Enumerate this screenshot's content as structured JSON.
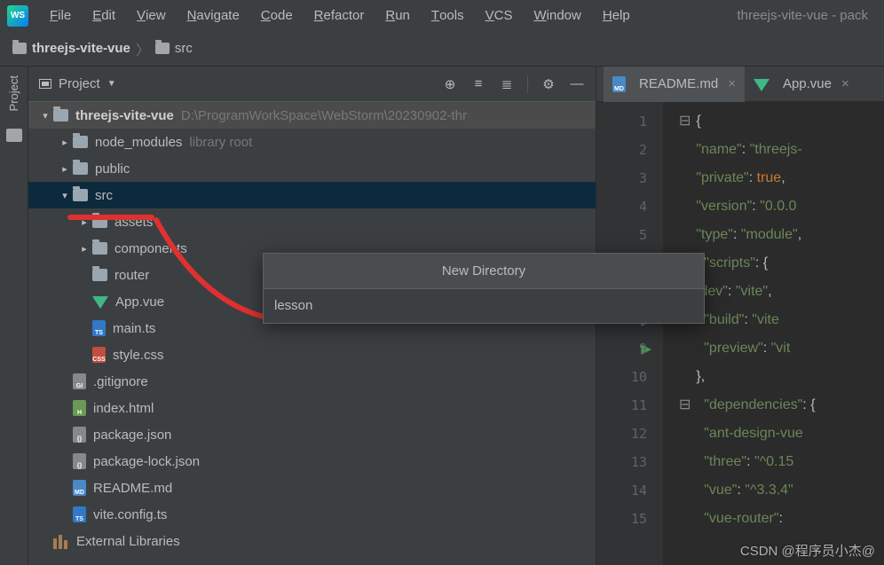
{
  "menubar": {
    "items": [
      "File",
      "Edit",
      "View",
      "Navigate",
      "Code",
      "Refactor",
      "Run",
      "Tools",
      "VCS",
      "Window",
      "Help"
    ],
    "window_title": "threejs-vite-vue - pack"
  },
  "breadcrumb": {
    "project": "threejs-vite-vue",
    "path": "src"
  },
  "side_tab": {
    "label": "Project"
  },
  "panel": {
    "title": "Project",
    "tools": [
      "target",
      "collapse",
      "expand",
      "divider",
      "gear",
      "hide"
    ]
  },
  "tree": [
    {
      "depth": 0,
      "exp": "v",
      "icon": "folder",
      "label": "threejs-vite-vue",
      "suffix": "D:\\ProgramWorkSpace\\WebStorm\\20230902-thr",
      "root": true
    },
    {
      "depth": 1,
      "exp": ">",
      "icon": "folder",
      "label": "node_modules",
      "suffix": "library root"
    },
    {
      "depth": 1,
      "exp": ">",
      "icon": "folder",
      "label": "public"
    },
    {
      "depth": 1,
      "exp": "v",
      "icon": "folder",
      "label": "src",
      "sel": true
    },
    {
      "depth": 2,
      "exp": ">",
      "icon": "folder",
      "label": "assets"
    },
    {
      "depth": 2,
      "exp": ">",
      "icon": "folder",
      "label": "components"
    },
    {
      "depth": 2,
      "exp": "",
      "icon": "folder",
      "label": "router"
    },
    {
      "depth": 2,
      "exp": "",
      "icon": "vue",
      "label": "App.vue"
    },
    {
      "depth": 2,
      "exp": "",
      "icon": "ts",
      "label": "main.ts"
    },
    {
      "depth": 2,
      "exp": "",
      "icon": "css",
      "label": "style.css"
    },
    {
      "depth": 1,
      "exp": "",
      "icon": "git",
      "label": ".gitignore"
    },
    {
      "depth": 1,
      "exp": "",
      "icon": "html",
      "label": "index.html"
    },
    {
      "depth": 1,
      "exp": "",
      "icon": "json",
      "label": "package.json"
    },
    {
      "depth": 1,
      "exp": "",
      "icon": "json",
      "label": "package-lock.json"
    },
    {
      "depth": 1,
      "exp": "",
      "icon": "md",
      "label": "README.md"
    },
    {
      "depth": 1,
      "exp": "",
      "icon": "ts",
      "label": "vite.config.ts"
    },
    {
      "depth": 0,
      "exp": "",
      "icon": "lib",
      "label": "External Libraries"
    }
  ],
  "tabs": [
    {
      "icon": "md",
      "label": "README.md"
    },
    {
      "icon": "vue",
      "label": "App.vue"
    }
  ],
  "code": {
    "lines": [
      {
        "n": 1,
        "fold": true,
        "text_html": "<span class='p'>{</span>"
      },
      {
        "n": 2,
        "text_html": "  <span class='s'>\"name\"</span><span class='p'>: </span><span class='s'>\"threejs-</span>"
      },
      {
        "n": 3,
        "text_html": "  <span class='s'>\"private\"</span><span class='p'>: </span><span class='k'>true</span><span class='p'>,</span>"
      },
      {
        "n": 4,
        "text_html": "  <span class='s'>\"version\"</span><span class='p'>: </span><span class='s'>\"0.0.0</span>"
      },
      {
        "n": 5,
        "text_html": "  <span class='s'>\"type\"</span><span class='p'>: </span><span class='s'>\"module\"</span><span class='p'>,</span>"
      },
      {
        "n": 6,
        "fold": true,
        "text_html": "  <span class='s'>\"scripts\"</span><span class='p'>: {</span>"
      },
      {
        "n": 7,
        "hidden": true
      },
      {
        "n": 8,
        "run": true,
        "text_html": "    <span class='s'>\"build\"</span><span class='p'>: </span><span class='s'>\"vite</span>"
      },
      {
        "n": 9,
        "run": true,
        "text_html": "    <span class='s'>\"preview\"</span><span class='p'>: </span><span class='s'>\"vit</span>"
      },
      {
        "n": 10,
        "text_html": "  <span class='p'>},</span>"
      },
      {
        "n": 11,
        "fold": true,
        "text_html": "  <span class='s'>\"dependencies\"</span><span class='p'>: {</span>"
      },
      {
        "n": 12,
        "text_html": "    <span class='s'>\"ant-design-vue</span>"
      },
      {
        "n": 13,
        "text_html": "    <span class='s'>\"three\"</span><span class='p'>: </span><span class='s'>\"^0.15</span>"
      },
      {
        "n": 14,
        "text_html": "    <span class='s'>\"vue\"</span><span class='p'>: </span><span class='s'>\"^3.3.4\"</span>"
      },
      {
        "n": 15,
        "text_html": "    <span class='s'>\"vue-router\"</span><span class='p'>: </span>"
      }
    ],
    "hidden_line_text": "    \"dev\": \"vite\","
  },
  "dialog": {
    "title": "New Directory",
    "value": "lesson"
  },
  "watermark": "CSDN @程序员小杰@"
}
